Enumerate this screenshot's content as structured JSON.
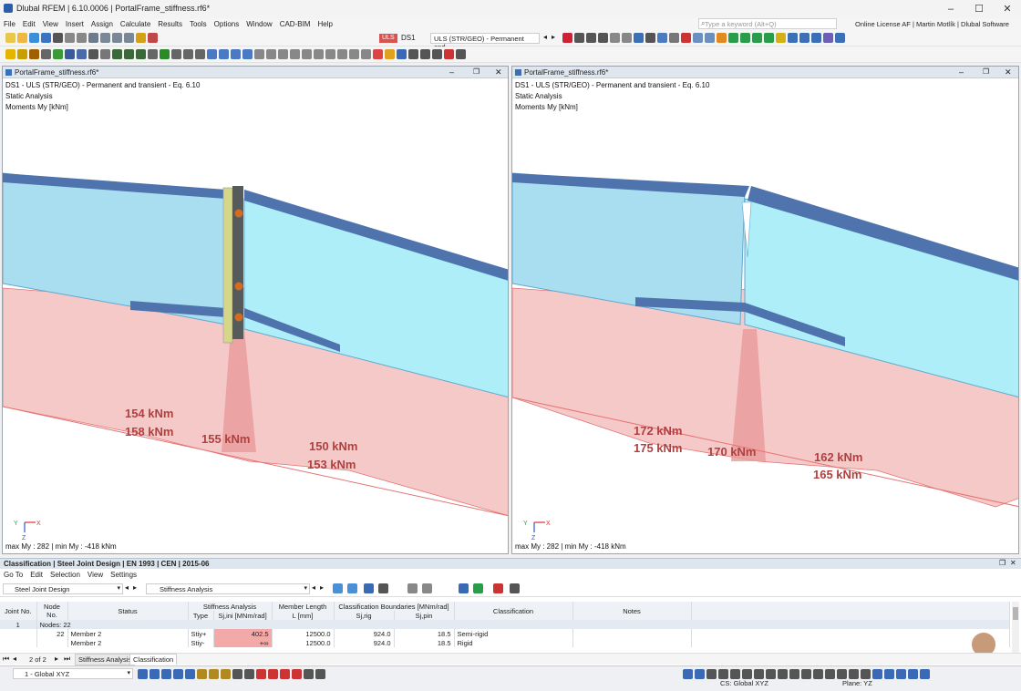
{
  "app": {
    "title": "Dlubal RFEM | 6.10.0006 | PortalFrame_stiffness.rf6*",
    "search_placeholder": "Type a keyword (Alt+Q)",
    "license": "Online License AF | Martin Motlík | Dlubal Software s.r.o."
  },
  "menu": [
    "File",
    "Edit",
    "View",
    "Insert",
    "Assign",
    "Calculate",
    "Results",
    "Tools",
    "Options",
    "Window",
    "CAD-BIM",
    "Help"
  ],
  "toolbar": {
    "uls_badge": "ULS",
    "ds": "DS1",
    "combo": "ULS (STR/GEO) - Permanent and..."
  },
  "viewports": [
    {
      "tab": "PortalFrame_stiffness.rf6*",
      "line1": "DS1 - ULS (STR/GEO) - Permanent and transient - Eq. 6.10",
      "line2": "Static Analysis",
      "line3": "Moments My [kNm]",
      "labels": [
        "154 kNm",
        "158 kNm",
        "155 kNm",
        "150 kNm",
        "153 kNm"
      ],
      "footer": "max My : 282 | min My : -418 kNm"
    },
    {
      "tab": "PortalFrame_stiffness.rf6*",
      "line1": "DS1 - ULS (STR/GEO) - Permanent and transient - Eq. 6.10",
      "line2": "Static Analysis",
      "line3": "Moments My [kNm]",
      "labels": [
        "172 kNm",
        "175 kNm",
        "170 kNm",
        "162 kNm",
        "165 kNm"
      ],
      "footer": "max My : 282 | min My : -418 kNm"
    }
  ],
  "axes": {
    "x": "X",
    "y": "Y",
    "z": "Z"
  },
  "panel": {
    "title": "Classification | Steel Joint Design | EN 1993 | CEN | 2015-06",
    "menu": [
      "Go To",
      "Edit",
      "Selection",
      "View",
      "Settings"
    ],
    "module": "Steel Joint Design",
    "analysis": "Stiffness Analysis",
    "headers": {
      "joint": "Joint No.",
      "node": "Node No.",
      "status": "Status",
      "stiff_group": "Stiffness Analysis",
      "type": "Type",
      "sjini": "Sj,ini [MNm/rad]",
      "member_len_group": "Member Length",
      "len": "L [mm]",
      "class_group": "Classification Boundaries [MNm/rad]",
      "sjrig": "Sj,rig",
      "sjpin": "Sj,pin",
      "classification": "Classification",
      "notes": "Notes"
    },
    "group_row": {
      "joint": "1",
      "text": "Nodes: 22"
    },
    "rows": [
      {
        "node": "22",
        "member": "Member 2",
        "type": "Stiy+",
        "sjini": "402.5",
        "len": "12500.0",
        "sjrig": "924.0",
        "sjpin": "18.5",
        "classification": "Semi-rigid"
      },
      {
        "node": "",
        "member": "Member 2",
        "type": "Stiy-",
        "sjini": "+∞",
        "len": "12500.0",
        "sjrig": "924.0",
        "sjpin": "18.5",
        "classification": "Rigid"
      }
    ],
    "pager": "2 of 2",
    "tabs": [
      "Stiffness Analysis",
      "Classification"
    ]
  },
  "status": {
    "cs_select": "1 - Global XYZ",
    "cs": "CS: Global XYZ",
    "plane": "Plane: YZ"
  }
}
